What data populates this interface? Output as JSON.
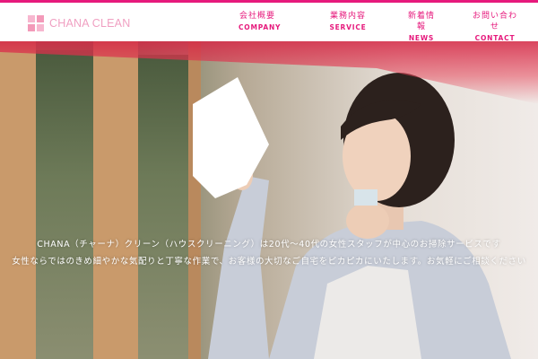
{
  "brand": {
    "name": "CHANA CLEAN",
    "accent": "#e6197c",
    "logo_color": "#f0a0c2"
  },
  "nav": [
    {
      "jp": "会社概要",
      "en": "COMPANY"
    },
    {
      "jp": "業務内容",
      "en": "SERVICE"
    },
    {
      "jp": "新着情報",
      "en": "NEWS"
    },
    {
      "jp": "お問い合わせ",
      "en": "CONTACT"
    }
  ],
  "hero": {
    "image_icon": "woman-cleaning-window-photo",
    "caption_line1": "CHANA（チャーナ）クリーン（ハウスクリーニング）は20代〜40代の女性スタッフが中心のお掃除サービスです",
    "caption_line2": "女性ならではのきめ細やかな気配りと丁寧な作業で、お客様の大切なご自宅をピカピカにいたします。お気軽にご相談ください"
  }
}
